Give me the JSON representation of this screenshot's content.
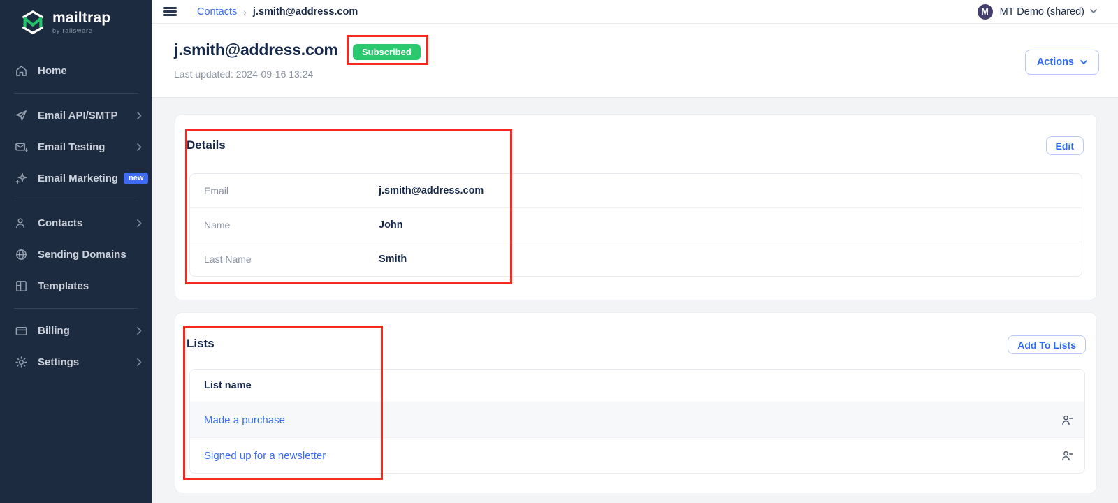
{
  "sidebar": {
    "logo": {
      "name": "mailtrap",
      "byline": "by railsware"
    },
    "items": [
      {
        "label": "Home",
        "icon": "home-icon"
      },
      {
        "label": "Email API/SMTP",
        "icon": "send-icon",
        "chevron": true
      },
      {
        "label": "Email Testing",
        "icon": "email-testing-icon",
        "chevron": true
      },
      {
        "label": "Email Marketing",
        "icon": "sparkles-icon",
        "badge": "new"
      },
      {
        "label": "Contacts",
        "icon": "contacts-icon",
        "chevron": true
      },
      {
        "label": "Sending Domains",
        "icon": "globe-icon"
      },
      {
        "label": "Templates",
        "icon": "templates-icon"
      },
      {
        "label": "Billing",
        "icon": "billing-icon",
        "chevron": true
      },
      {
        "label": "Settings",
        "icon": "gear-icon",
        "chevron": true
      }
    ]
  },
  "topbar": {
    "hamburger_icon": "menu-icon",
    "breadcrumb": {
      "parent": "Contacts",
      "current": "j.smith@address.com"
    },
    "account": {
      "initial": "M",
      "name": "MT Demo (shared)"
    }
  },
  "header": {
    "title": "j.smith@address.com",
    "status_badge": "Subscribed",
    "last_updated": "Last updated: 2024-09-16 13:24",
    "actions_label": "Actions"
  },
  "details": {
    "title": "Details",
    "edit_label": "Edit",
    "rows": [
      {
        "label": "Email",
        "value": "j.smith@address.com"
      },
      {
        "label": "Name",
        "value": "John"
      },
      {
        "label": "Last Name",
        "value": "Smith"
      }
    ]
  },
  "lists": {
    "title": "Lists",
    "add_label": "Add To Lists",
    "column_header": "List name",
    "row_icon": "person-minus-icon",
    "rows": [
      {
        "name": "Made a purchase"
      },
      {
        "name": "Signed up for a newsletter"
      }
    ]
  },
  "annotations": {
    "color": "#f5291d",
    "boxes": [
      "subscribed-badge-highlight",
      "details-section-highlight",
      "lists-section-highlight"
    ]
  },
  "colors": {
    "sidebar_bg": "#1d2b41",
    "accent_blue": "#2f6bf2",
    "badge_green": "#2bc96e",
    "annotation_red": "#f5291d",
    "navy_text": "#16284a"
  }
}
